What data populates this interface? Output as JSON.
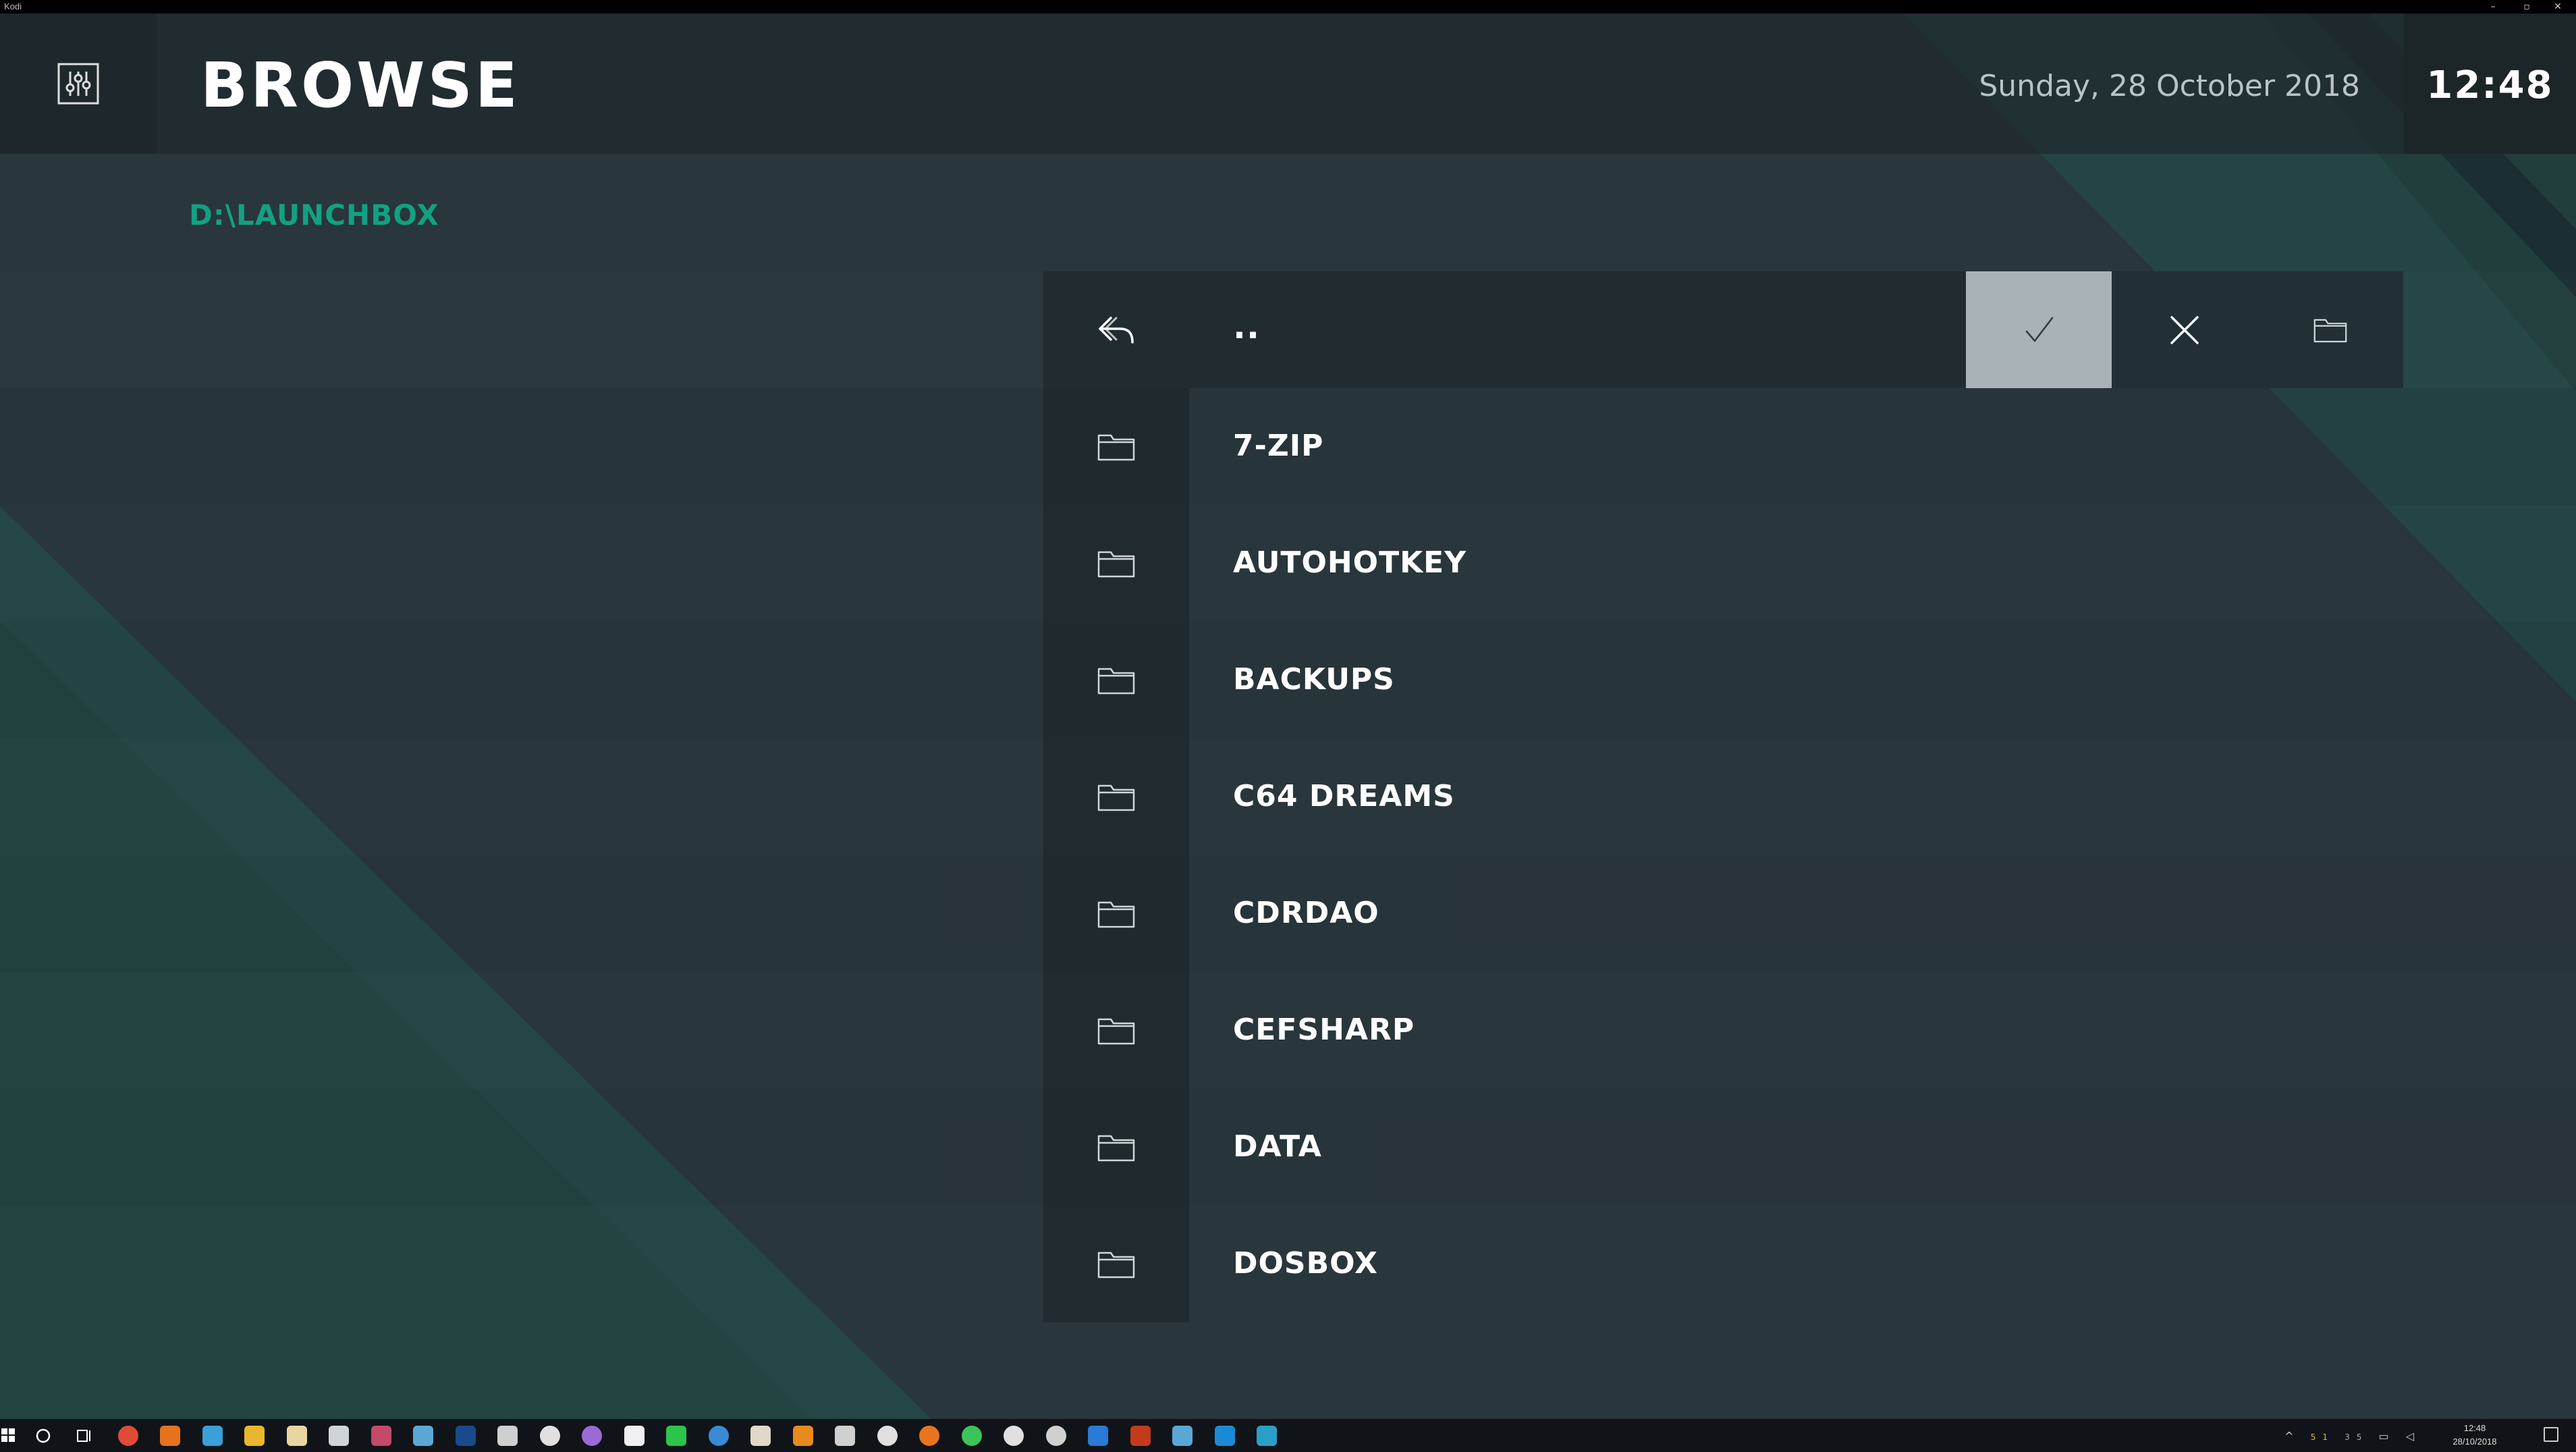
{
  "window": {
    "title": "Kodi",
    "minimize": "–",
    "maximize": "▫",
    "close": "✕"
  },
  "header": {
    "title": "BROWSE",
    "date": "Sunday, 28 October 2018",
    "clock": "12:48",
    "menu_icon": "settings-sliders-icon"
  },
  "path": "D:\\LAUNCHBOX",
  "list": {
    "parent_label": "..",
    "items": [
      {
        "label": "7-ZIP"
      },
      {
        "label": "AUTOHOTKEY"
      },
      {
        "label": "BACKUPS"
      },
      {
        "label": "C64 DREAMS"
      },
      {
        "label": "CDRDAO"
      },
      {
        "label": "CEFSHARP"
      },
      {
        "label": "DATA"
      },
      {
        "label": "DOSBOX"
      }
    ]
  },
  "actions": {
    "ok_icon": "checkmark-icon",
    "cancel_icon": "close-icon",
    "new_folder_icon": "folder-icon"
  },
  "taskbar": {
    "tray_time": "12:48",
    "tray_date": "28/10/2018",
    "tray_num_1": "51",
    "tray_num_2": "35"
  },
  "colors": {
    "accent": "#12a183",
    "background": "#29363c",
    "header": "#1e282c",
    "ok_button": "#a9b2b6"
  }
}
